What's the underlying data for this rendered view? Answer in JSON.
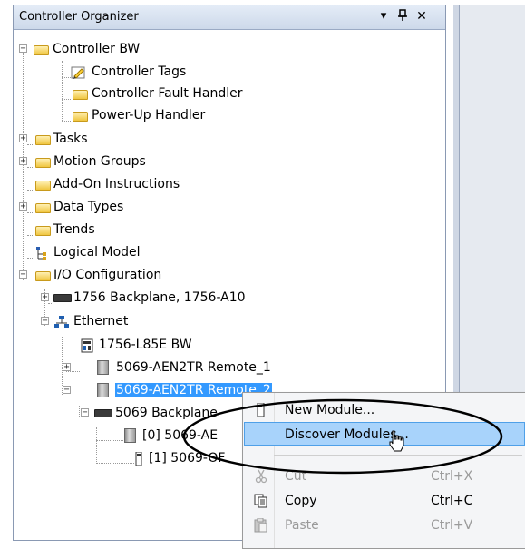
{
  "panel": {
    "title": "Controller Organizer",
    "menu_glyph": "▾",
    "pin_glyph": "ᵖ",
    "close_glyph": "✕"
  },
  "tree": {
    "controller": "Controller BW",
    "controller_tags": "Controller Tags",
    "fault_handler": "Controller Fault Handler",
    "powerup_handler": "Power-Up Handler",
    "tasks": "Tasks",
    "motion_groups": "Motion Groups",
    "addon": "Add-On Instructions",
    "data_types": "Data Types",
    "trends": "Trends",
    "logical_model": "Logical Model",
    "io_config": "I/O Configuration",
    "backplane_1756": "1756 Backplane, 1756-A10",
    "ethernet": "Ethernet",
    "l85e": "1756-L85E BW",
    "remote1": "5069-AEN2TR Remote_1",
    "remote2": "5069-AEN2TR Remote_2",
    "backplane_5069": "5069 Backplane",
    "slot0": "[0] 5069-AE",
    "slot1": "[1] 5069-OF",
    "expand_plus": "+",
    "expand_minus": "−"
  },
  "context_menu": {
    "new_module": {
      "label": "New Module...",
      "shortcut": "",
      "icon": "module-icon"
    },
    "discover": {
      "label": "Discover Modules...",
      "shortcut": "",
      "icon": ""
    },
    "cut": {
      "label": "Cut",
      "shortcut": "Ctrl+X",
      "icon": "scissors-icon"
    },
    "copy": {
      "label": "Copy",
      "shortcut": "Ctrl+C",
      "icon": "copy-icon"
    },
    "paste": {
      "label": "Paste",
      "shortcut": "Ctrl+V",
      "icon": "paste-icon"
    }
  },
  "colors": {
    "selection": "#3399ff",
    "menu_highlight": "#a8d3fb",
    "folder": "#f0c640"
  }
}
